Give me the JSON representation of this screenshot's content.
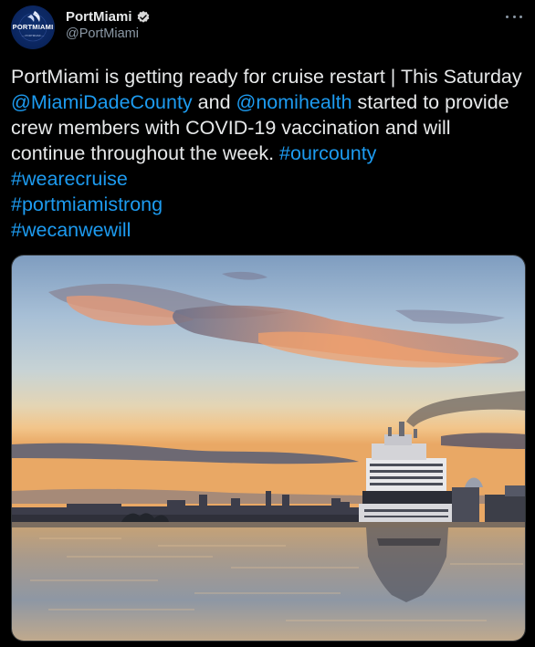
{
  "author": {
    "display_name": "PortMiami",
    "handle": "@PortMiami",
    "verified": true,
    "avatar_text": "PORTMIAMI",
    "avatar_subtext": "— PORTMIAMI —"
  },
  "tweet": {
    "text_before": "PortMiami is getting ready for cruise restart | This Saturday ",
    "mention1": "@MiamiDadeCounty",
    "text_mid": " and ",
    "mention2": "@nomihealth",
    "text_after": " started to provide crew members with COVID-19 vaccination and will continue throughout the week.  ",
    "hashtags": [
      "#ourcounty",
      "#wearecruise",
      "#portmiamistrong",
      "#wecanwewill"
    ]
  },
  "colors": {
    "background": "#000000",
    "text": "#e7e9ea",
    "secondary": "#8b98a5",
    "link": "#1d9bf0",
    "verified": "#d9d9d9"
  },
  "icons": {
    "more": "more-icon",
    "verified": "verified-badge-icon"
  }
}
